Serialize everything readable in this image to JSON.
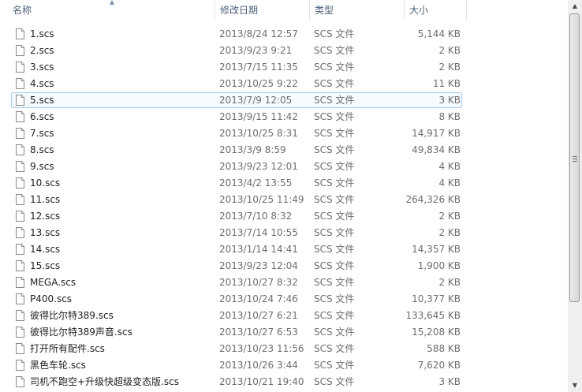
{
  "columns": {
    "name": "名称",
    "date": "修改日期",
    "type": "类型",
    "size": "大小"
  },
  "sort": {
    "column": "name",
    "direction": "ascending",
    "indicator": "▲"
  },
  "icons": {
    "file": "blank-file-icon"
  },
  "selected_index": 4,
  "scrollbar": {
    "up_glyph": "▲",
    "down_glyph": "▼"
  },
  "files": [
    {
      "name": "1.scs",
      "date": "2013/8/24 12:57",
      "type": "SCS 文件",
      "size": "5,144 KB"
    },
    {
      "name": "2.scs",
      "date": "2013/9/23 9:21",
      "type": "SCS 文件",
      "size": "2 KB"
    },
    {
      "name": "3.scs",
      "date": "2013/7/15 11:35",
      "type": "SCS 文件",
      "size": "2 KB"
    },
    {
      "name": "4.scs",
      "date": "2013/10/25 9:22",
      "type": "SCS 文件",
      "size": "11 KB"
    },
    {
      "name": "5.scs",
      "date": "2013/7/9 12:05",
      "type": "SCS 文件",
      "size": "3 KB"
    },
    {
      "name": "6.scs",
      "date": "2013/9/15 11:42",
      "type": "SCS 文件",
      "size": "8 KB"
    },
    {
      "name": "7.scs",
      "date": "2013/10/25 8:31",
      "type": "SCS 文件",
      "size": "14,917 KB"
    },
    {
      "name": "8.scs",
      "date": "2013/3/9 8:59",
      "type": "SCS 文件",
      "size": "49,834 KB"
    },
    {
      "name": "9.scs",
      "date": "2013/9/23 12:01",
      "type": "SCS 文件",
      "size": "4 KB"
    },
    {
      "name": "10.scs",
      "date": "2013/4/2 13:55",
      "type": "SCS 文件",
      "size": "4 KB"
    },
    {
      "name": "11.scs",
      "date": "2013/10/25 11:49",
      "type": "SCS 文件",
      "size": "264,326 KB"
    },
    {
      "name": "12.scs",
      "date": "2013/7/10 8:32",
      "type": "SCS 文件",
      "size": "2 KB"
    },
    {
      "name": "13.scs",
      "date": "2013/7/14 10:55",
      "type": "SCS 文件",
      "size": "2 KB"
    },
    {
      "name": "14.scs",
      "date": "2013/1/14 14:41",
      "type": "SCS 文件",
      "size": "14,357 KB"
    },
    {
      "name": "15.scs",
      "date": "2013/9/23 12:04",
      "type": "SCS 文件",
      "size": "1,900 KB"
    },
    {
      "name": "MEGA.scs",
      "date": "2013/10/27 8:32",
      "type": "SCS 文件",
      "size": "2 KB"
    },
    {
      "name": "P400.scs",
      "date": "2013/10/24 7:46",
      "type": "SCS 文件",
      "size": "10,377 KB"
    },
    {
      "name": "彼得比尔特389.scs",
      "date": "2013/10/27 6:21",
      "type": "SCS 文件",
      "size": "133,645 KB"
    },
    {
      "name": "彼得比尔特389声音.scs",
      "date": "2013/10/27 6:53",
      "type": "SCS 文件",
      "size": "15,208 KB"
    },
    {
      "name": "打开所有配件.scs",
      "date": "2013/10/23 11:56",
      "type": "SCS 文件",
      "size": "588 KB"
    },
    {
      "name": "黑色车轮.scs",
      "date": "2013/10/26 3:44",
      "type": "SCS 文件",
      "size": "7,620 KB"
    },
    {
      "name": "司机不跑空+升级快超级变态版.scs",
      "date": "2013/10/21 19:40",
      "type": "SCS 文件",
      "size": "3 KB"
    }
  ]
}
